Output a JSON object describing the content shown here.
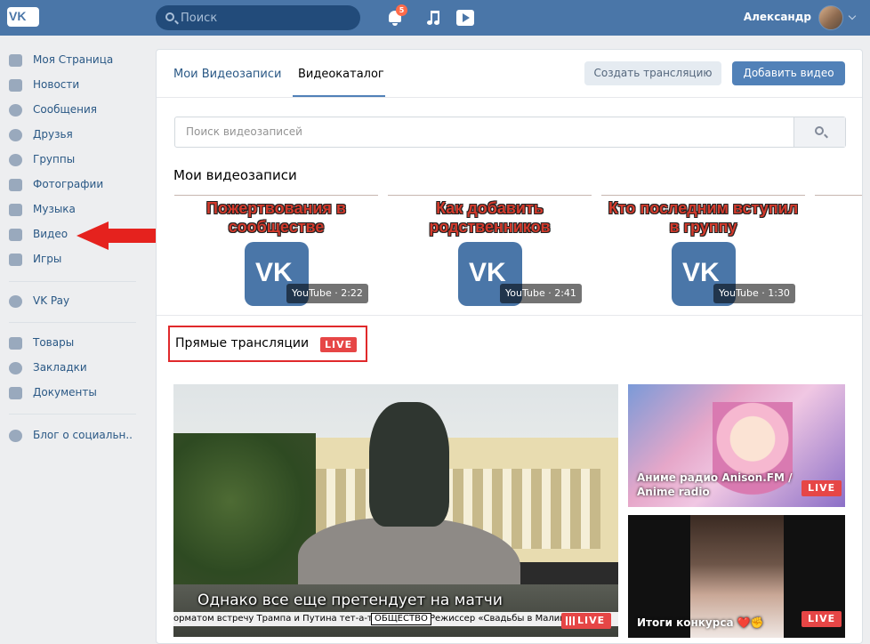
{
  "header": {
    "logo": "VK",
    "search_placeholder": "Поиск",
    "notifications_count": "5",
    "user_name": "Александр"
  },
  "sidebar": {
    "items": [
      {
        "label": "Моя Страница",
        "icon": "home-icon"
      },
      {
        "label": "Новости",
        "icon": "news-icon"
      },
      {
        "label": "Сообщения",
        "icon": "messages-icon"
      },
      {
        "label": "Друзья",
        "icon": "friend-icon"
      },
      {
        "label": "Группы",
        "icon": "groups-icon"
      },
      {
        "label": "Фотографии",
        "icon": "camera-icon"
      },
      {
        "label": "Музыка",
        "icon": "music-icon"
      },
      {
        "label": "Видео",
        "icon": "film-icon"
      },
      {
        "label": "Игры",
        "icon": "gamepad-icon"
      },
      {
        "label": "VK Pay",
        "icon": "vkpay-icon"
      },
      {
        "label": "Товары",
        "icon": "bag-icon"
      },
      {
        "label": "Закладки",
        "icon": "star-icon"
      },
      {
        "label": "Документы",
        "icon": "document-icon"
      },
      {
        "label": "Блог о социальн..",
        "icon": "community-icon"
      }
    ]
  },
  "main": {
    "tabs": [
      {
        "label": "Мои Видеозаписи"
      },
      {
        "label": "Видеокаталог"
      }
    ],
    "create_stream_label": "Создать трансляцию",
    "add_video_label": "Добавить видео",
    "search_placeholder": "Поиск видеозаписей",
    "my_videos_title": "Мои видеозаписи",
    "videos": [
      {
        "caption": "Пожертвования в сообществе",
        "duration": "YouTube · 2:22"
      },
      {
        "caption": "Как добавить родственников",
        "duration": "YouTube · 2:41"
      },
      {
        "caption": "Кто последним вступил в группу",
        "duration": "YouTube · 1:30"
      }
    ],
    "live_title": "Прямые трансляции",
    "live_badge": "LIVE",
    "big_stream": {
      "subtitle": "Однако все еще претендует на матчи",
      "ticker_left": "орматом встречу Трампа и Путина тет-а-тет",
      "ticker_tag": "ОБЩЕСТВО",
      "ticker_right": "Режиссер «Свадьбы в Малино",
      "badge": "LIVE"
    },
    "side_streams": [
      {
        "title": "Аниме радио Anison.FM / Anime radio",
        "badge": "LIVE"
      },
      {
        "title": "Итоги конкурса ❤️✊",
        "badge": "LIVE"
      }
    ]
  },
  "colors": {
    "header": "#4a76a8",
    "link": "#2a5885",
    "accent_button": "#5181b8",
    "live_red": "#e64646",
    "annotation_red": "#e0292b"
  }
}
